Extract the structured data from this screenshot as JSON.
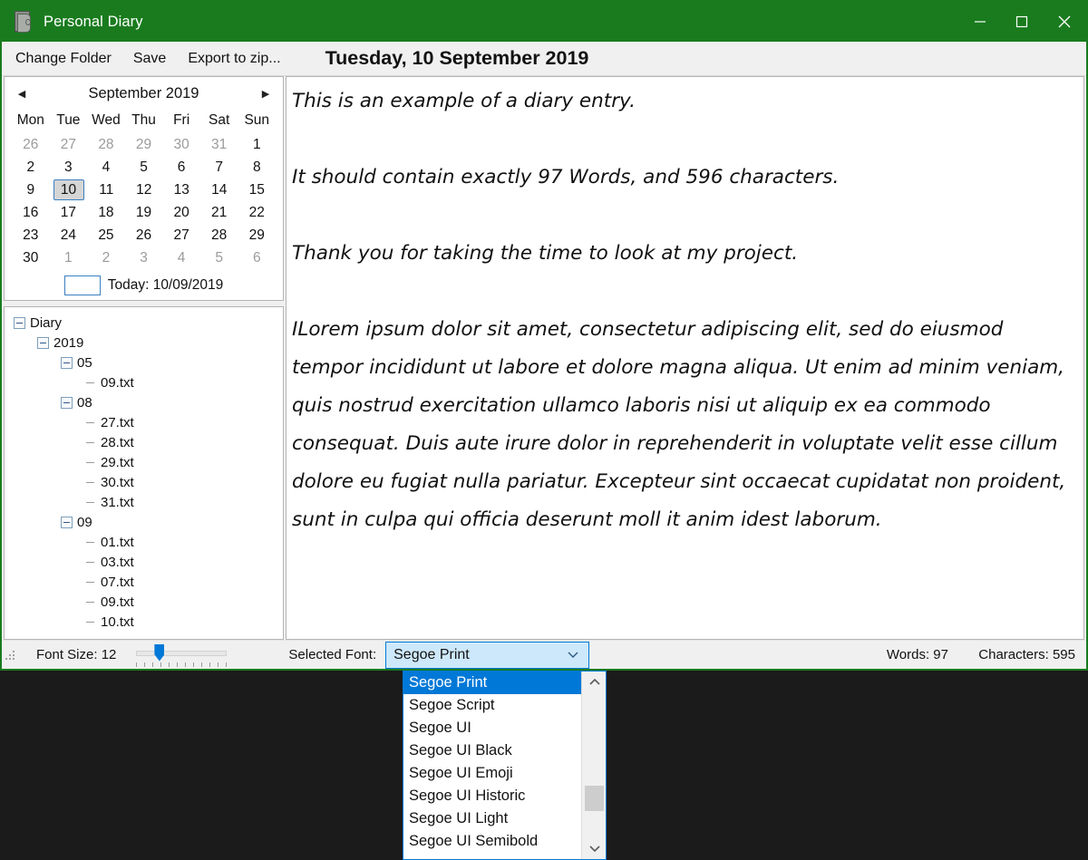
{
  "window": {
    "title": "Personal Diary",
    "icon": "diary-book-icon",
    "accent_color": "#197b1e",
    "controls": {
      "minimize": "minimize-icon",
      "maximize": "maximize-icon",
      "close": "close-icon"
    }
  },
  "toolbar": {
    "change_folder_label": "Change Folder",
    "save_label": "Save",
    "export_label": "Export to zip...",
    "date_header": "Tuesday, 10 September 2019"
  },
  "calendar": {
    "prev_icon": "◀",
    "next_icon": "▶",
    "title": "September 2019",
    "day_names": [
      "Mon",
      "Tue",
      "Wed",
      "Thu",
      "Fri",
      "Sat",
      "Sun"
    ],
    "weeks": [
      [
        {
          "d": "26",
          "muted": true
        },
        {
          "d": "27",
          "muted": true
        },
        {
          "d": "28",
          "muted": true
        },
        {
          "d": "29",
          "muted": true
        },
        {
          "d": "30",
          "muted": true
        },
        {
          "d": "31",
          "muted": true
        },
        {
          "d": "1",
          "muted": false
        }
      ],
      [
        {
          "d": "2",
          "muted": false
        },
        {
          "d": "3",
          "muted": false
        },
        {
          "d": "4",
          "muted": false
        },
        {
          "d": "5",
          "muted": false
        },
        {
          "d": "6",
          "muted": false
        },
        {
          "d": "7",
          "muted": false
        },
        {
          "d": "8",
          "muted": false
        }
      ],
      [
        {
          "d": "9",
          "muted": false
        },
        {
          "d": "10",
          "muted": false,
          "selected": true
        },
        {
          "d": "11",
          "muted": false
        },
        {
          "d": "12",
          "muted": false
        },
        {
          "d": "13",
          "muted": false
        },
        {
          "d": "14",
          "muted": false
        },
        {
          "d": "15",
          "muted": false
        }
      ],
      [
        {
          "d": "16",
          "muted": false
        },
        {
          "d": "17",
          "muted": false
        },
        {
          "d": "18",
          "muted": false
        },
        {
          "d": "19",
          "muted": false
        },
        {
          "d": "20",
          "muted": false
        },
        {
          "d": "21",
          "muted": false
        },
        {
          "d": "22",
          "muted": false
        }
      ],
      [
        {
          "d": "23",
          "muted": false
        },
        {
          "d": "24",
          "muted": false
        },
        {
          "d": "25",
          "muted": false
        },
        {
          "d": "26",
          "muted": false
        },
        {
          "d": "27",
          "muted": false
        },
        {
          "d": "28",
          "muted": false
        },
        {
          "d": "29",
          "muted": false
        }
      ],
      [
        {
          "d": "30",
          "muted": false
        },
        {
          "d": "1",
          "muted": true
        },
        {
          "d": "2",
          "muted": true
        },
        {
          "d": "3",
          "muted": true
        },
        {
          "d": "4",
          "muted": true
        },
        {
          "d": "5",
          "muted": true
        },
        {
          "d": "6",
          "muted": true
        }
      ]
    ],
    "today_label": "Today: 10/09/2019",
    "selected_day": "10"
  },
  "tree": {
    "nodes": [
      {
        "label": "Diary",
        "depth": 0,
        "type": "folder"
      },
      {
        "label": "2019",
        "depth": 1,
        "type": "folder"
      },
      {
        "label": "05",
        "depth": 2,
        "type": "folder"
      },
      {
        "label": "09.txt",
        "depth": 3,
        "type": "file"
      },
      {
        "label": "08",
        "depth": 2,
        "type": "folder"
      },
      {
        "label": "27.txt",
        "depth": 3,
        "type": "file"
      },
      {
        "label": "28.txt",
        "depth": 3,
        "type": "file"
      },
      {
        "label": "29.txt",
        "depth": 3,
        "type": "file"
      },
      {
        "label": "30.txt",
        "depth": 3,
        "type": "file"
      },
      {
        "label": "31.txt",
        "depth": 3,
        "type": "file"
      },
      {
        "label": "09",
        "depth": 2,
        "type": "folder"
      },
      {
        "label": "01.txt",
        "depth": 3,
        "type": "file"
      },
      {
        "label": "03.txt",
        "depth": 3,
        "type": "file"
      },
      {
        "label": "07.txt",
        "depth": 3,
        "type": "file"
      },
      {
        "label": "09.txt",
        "depth": 3,
        "type": "file"
      },
      {
        "label": "10.txt",
        "depth": 3,
        "type": "file"
      }
    ]
  },
  "editor": {
    "content": "This is an example of a diary entry.\n\nIt should contain exactly 97 Words, and 596 characters.\n\nThank you for taking the time to look at my project.\n\nILorem ipsum dolor sit amet, consectetur adipiscing elit, sed do eiusmod tempor incididunt ut labore et dolore magna aliqua. Ut enim ad minim veniam, quis nostrud exercitation ullamco laboris nisi ut aliquip ex ea commodo consequat. Duis aute irure dolor in reprehenderit in voluptate velit esse cillum dolore eu fugiat nulla pariatur. Excepteur sint occaecat cupidatat non proident, sunt in culpa qui officia deserunt moll it anim idest laborum."
  },
  "status": {
    "font_size_label": "Font Size: 12",
    "selected_font_label": "Selected Font:",
    "selected_font_value": "Segoe Print",
    "word_count": "Words: 97",
    "char_count": "Characters: 595",
    "combo_arrow_icon": "chevron-down-icon"
  },
  "font_dropdown": {
    "items": [
      {
        "label": "Segoe Print",
        "selected": true
      },
      {
        "label": "Segoe Script",
        "selected": false
      },
      {
        "label": "Segoe UI",
        "selected": false
      },
      {
        "label": "Segoe UI Black",
        "selected": false
      },
      {
        "label": "Segoe UI Emoji",
        "selected": false
      },
      {
        "label": "Segoe UI Historic",
        "selected": false
      },
      {
        "label": "Segoe UI Light",
        "selected": false
      },
      {
        "label": "Segoe UI Semibold",
        "selected": false
      }
    ],
    "scroll_up_icon": "chevron-up-icon",
    "scroll_down_icon": "chevron-down-icon"
  }
}
